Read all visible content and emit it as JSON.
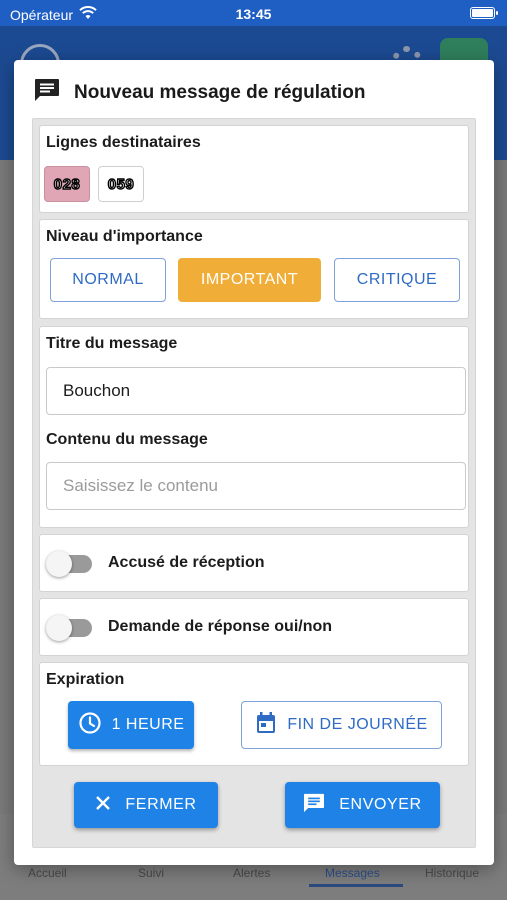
{
  "status_bar": {
    "carrier": "Opérateur",
    "time": "13:45"
  },
  "tabs": [
    {
      "label": "Accueil"
    },
    {
      "label": "Suivi"
    },
    {
      "label": "Alertes"
    },
    {
      "label": "Messages"
    },
    {
      "label": "Historique"
    }
  ],
  "dialog": {
    "title": "Nouveau message de régulation",
    "lines_section": {
      "title": "Lignes destinataires",
      "lines": [
        {
          "label": "028",
          "selected": true
        },
        {
          "label": "059",
          "selected": false
        }
      ]
    },
    "importance_section": {
      "title": "Niveau d'importance",
      "options": [
        "NORMAL",
        "IMPORTANT",
        "CRITIQUE"
      ],
      "selected": "IMPORTANT"
    },
    "message_section": {
      "title_label": "Titre du message",
      "title_value": "Bouchon",
      "content_label": "Contenu du message",
      "content_placeholder": "Saisissez le contenu"
    },
    "ack_toggle": {
      "label": "Accusé de réception",
      "on": false
    },
    "yesno_toggle": {
      "label": "Demande de réponse oui/non",
      "on": false
    },
    "expiration_section": {
      "title": "Expiration",
      "options": [
        "1 HEURE",
        "FIN DE JOURNÉE"
      ],
      "selected": "1 HEURE"
    },
    "actions": {
      "close_label": "FERMER",
      "send_label": "ENVOYER"
    }
  },
  "colors": {
    "primary": "#1f82e6",
    "important": "#f0ad37",
    "selected_line": "#e0a6b6"
  }
}
